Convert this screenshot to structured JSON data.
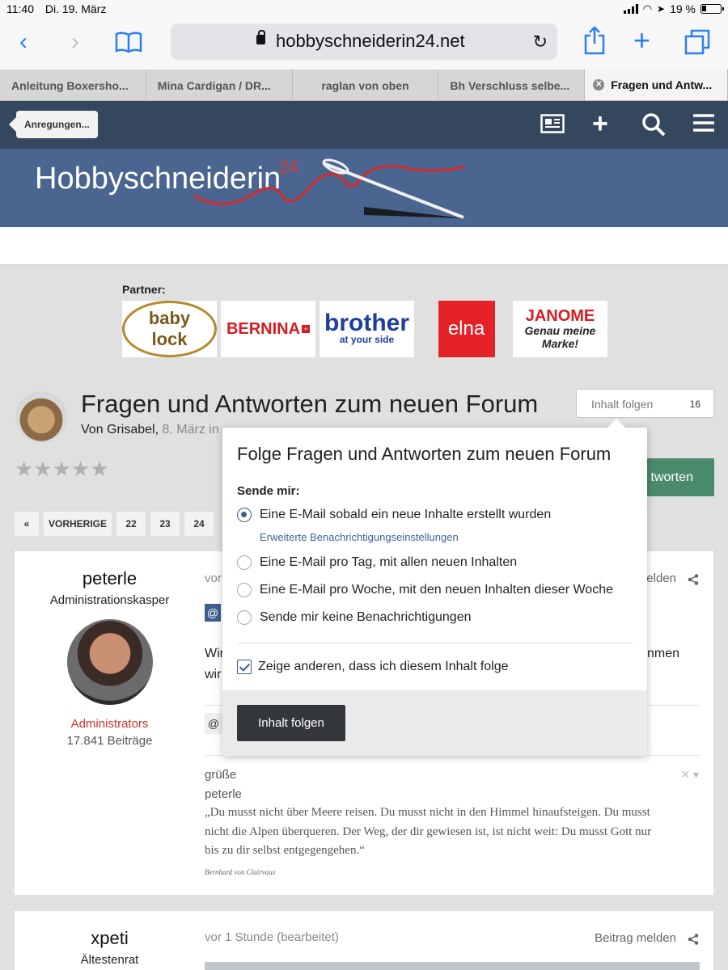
{
  "status_bar": {
    "time": "11:40",
    "date": "Di. 19. März",
    "battery": "19 %"
  },
  "browser": {
    "url": "hobbyschneiderin24.net",
    "tabs": [
      "Anleitung Boxersho...",
      "Mina Cardigan / DR...",
      "raglan von oben",
      "Bh Verschluss selbe...",
      "Fragen und Antw..."
    ]
  },
  "site": {
    "back_label": "Anregungen...",
    "logo_text": "Hobbyschneiderin",
    "logo_sup": "24",
    "partner_label": "Partner:",
    "partners": {
      "babylock": "baby lock",
      "bernina": "BERNINA",
      "brother": "brother",
      "brother_tagline": "at your side",
      "elna": "elna",
      "janome": "JANOME",
      "janome_tagline": "Genau meine Marke!"
    }
  },
  "topic": {
    "title": "Fragen und Antworten zum neuen Forum",
    "author_prefix": "Von Grisabel,",
    "date": "8. März in",
    "follow_label": "Inhalt folgen",
    "follow_count": "16",
    "reply_label": "Antworten",
    "reply_visible": "tworten",
    "pager": {
      "prev": "VORHERIGE",
      "pages": [
        "22",
        "23",
        "24"
      ]
    }
  },
  "post1": {
    "author": "peterle",
    "rank": "Administrationskasper",
    "group": "Administrators",
    "posts_count": "17.841 Beiträge",
    "meta": "vor",
    "report_label": "melden",
    "body_start": "Wir",
    "body_end": "nmen",
    "body_line2": "wir",
    "sig_greeting": "grüße",
    "sig_name": "peterle",
    "sig_quote": "„Du musst nicht über Meere reisen. Du musst nicht in den Himmel hinaufsteigen. Du musst nicht die Alpen überqueren. Der Weg, der dir gewiesen ist, ist nicht weit: Du musst Gott nur bis zu dir selbst entgegengehen.“",
    "sig_author": "Bernhard von Clairvaux"
  },
  "post2": {
    "author": "xpeti",
    "rank": "Ältestenrat",
    "meta": "vor 1 Stunde (bearbeitet)",
    "report_label": "Beitrag melden"
  },
  "popup": {
    "title": "Folge Fragen und Antworten zum neuen Forum",
    "send_label": "Sende mir:",
    "options": [
      "Eine E-Mail sobald ein neue Inhalte erstellt wurden",
      "Eine E-Mail pro Tag, mit allen neuen Inhalten",
      "Eine E-Mail pro Woche, mit den neuen Inhalten dieser Woche",
      "Sende mir keine Benachrichtigungen"
    ],
    "selected_option": 0,
    "advanced_link": "Erweiterte Benachrichtigungseinstellungen",
    "show_others": "Zeige anderen, dass ich diesem Inhalt folge",
    "show_others_checked": true,
    "submit_label": "Inhalt folgen"
  }
}
